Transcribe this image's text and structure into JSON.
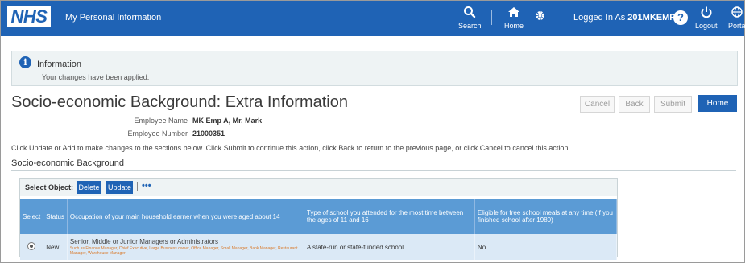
{
  "topbar": {
    "logo": "NHS",
    "app_title": "My Personal Information",
    "search_label": "Search",
    "home_label": "Home",
    "logged_in_prefix": "Logged In As",
    "user": "201MKEMPA",
    "help_glyph": "?",
    "logout_label": "Logout",
    "portal_label": "Porta"
  },
  "info": {
    "title": "Information",
    "message": "Your changes have been applied."
  },
  "page": {
    "title": "Socio-economic Background: Extra Information",
    "buttons": {
      "cancel": "Cancel",
      "back": "Back",
      "submit": "Submit",
      "home": "Home"
    },
    "employee_name_label": "Employee Name",
    "employee_name_value": "MK Emp A, Mr. Mark",
    "employee_number_label": "Employee Number",
    "employee_number_value": "21000351",
    "instructions": "Click Update or Add to make changes to the sections below. Click Submit to continue this action, click Back to return to the previous page, or click Cancel to cancel this action.",
    "section_title": "Socio-economic Background"
  },
  "table": {
    "select_object_label": "Select Object:",
    "delete_label": "Delete",
    "update_label": "Update",
    "more_label": "•••",
    "headers": [
      "Select",
      "Status",
      "Occupation of your main household earner when you were aged about 14",
      "Type of school you attended for the most time between the ages of 11 and 16",
      "Eligible for free school meals at any time (If you finished school after 1980)"
    ],
    "rows": [
      {
        "status": "New",
        "occupation": "Senior, Middle or Junior Managers or Administrators",
        "occupation_detail": "Such as Finance Manager, Chief Executive, Large Business owner, Office Manager, Small Manager, Bank Manager, Restaurant Manager, Warehouse Manager",
        "school": "A state-run or state-funded school",
        "free_meals": "No"
      }
    ]
  },
  "colors": {
    "brand_blue": "#1f63b5",
    "header_blue": "#5b9bd5",
    "row_blue": "#dbe9f6",
    "detail_orange": "#d97a2b"
  }
}
